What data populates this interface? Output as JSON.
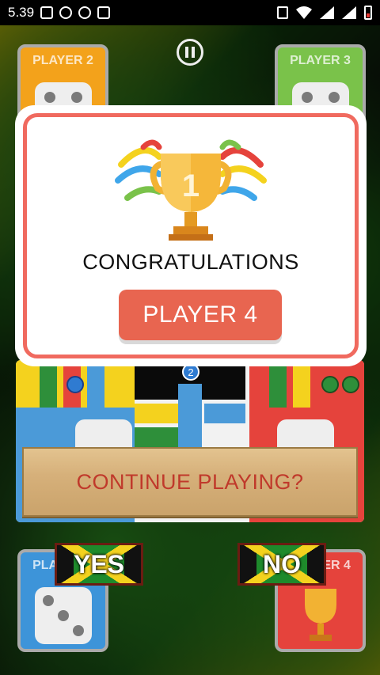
{
  "status_bar": {
    "time": "5.39"
  },
  "players": {
    "p1": "PLAYER 1",
    "p2": "PLAYER 2",
    "p3": "PLAYER 3",
    "p4": "PLAYER 4"
  },
  "board": {
    "marker_number": "2"
  },
  "dialog": {
    "heading": "CONGRATULATIONS",
    "trophy_number": "1",
    "winner_label": "PLAYER 4"
  },
  "prompt": {
    "question": "CONTINUE PLAYING?",
    "yes_label": "YES",
    "no_label": "NO"
  },
  "colors": {
    "accent": "#e86550",
    "dialog_border": "#f06a5f",
    "prompt_text": "#c0392b"
  }
}
